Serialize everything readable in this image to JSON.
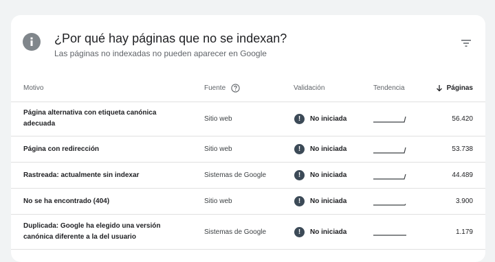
{
  "header": {
    "title": "¿Por qué hay páginas que no se indexan?",
    "subtitle": "Las páginas no indexadas no pueden aparecer en Google"
  },
  "table": {
    "columns": {
      "motivo": "Motivo",
      "fuente": "Fuente",
      "validacion": "Validación",
      "tendencia": "Tendencia",
      "paginas": "Páginas"
    },
    "rows": [
      {
        "motivo": "Página alternativa con etiqueta canónica adecuada",
        "fuente": "Sitio web",
        "validacion": "No iniciada",
        "paginas": "56.420",
        "trend": "rise"
      },
      {
        "motivo": "Página con redirección",
        "fuente": "Sitio web",
        "validacion": "No iniciada",
        "paginas": "53.738",
        "trend": "rise"
      },
      {
        "motivo": "Rastreada: actualmente sin indexar",
        "fuente": "Sistemas de Google",
        "validacion": "No iniciada",
        "paginas": "44.489",
        "trend": "rise"
      },
      {
        "motivo": "No se ha encontrado (404)",
        "fuente": "Sitio web",
        "validacion": "No iniciada",
        "paginas": "3.900",
        "trend": "flat-tick"
      },
      {
        "motivo": "Duplicada: Google ha elegido una versión canónica diferente a la del usuario",
        "fuente": "Sistemas de Google",
        "validacion": "No iniciada",
        "paginas": "1.179",
        "trend": "flat"
      }
    ]
  },
  "icons": {
    "info": "info-icon",
    "filter": "filter-icon",
    "help": "help-circle-icon",
    "sort": "arrow-down-icon",
    "warning": "exclamation-icon"
  },
  "colors": {
    "icon_gray": "#80868b",
    "warning_badge": "#3c4a57",
    "trend_line": "#3c4043"
  }
}
